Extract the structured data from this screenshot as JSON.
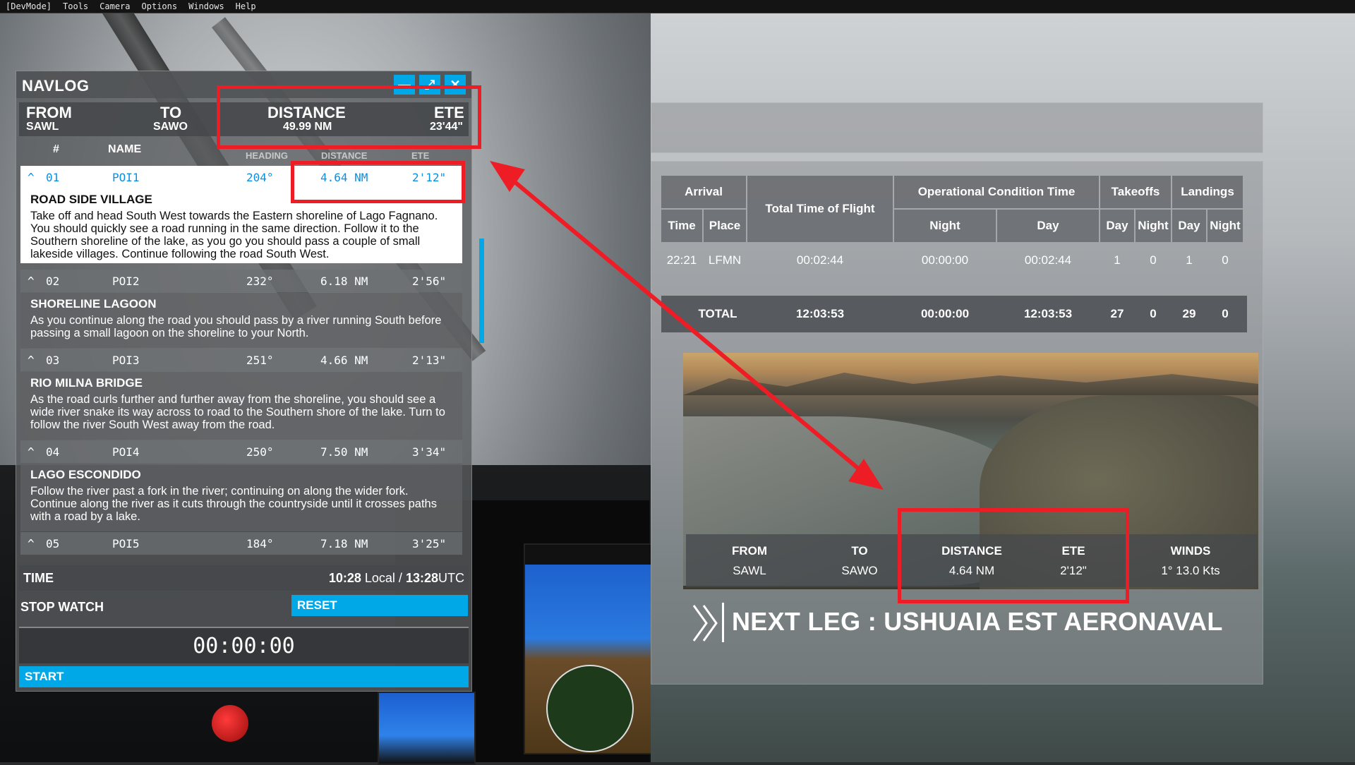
{
  "menu": [
    "[DevMode]",
    "Tools",
    "Camera",
    "Options",
    "Windows",
    "Help"
  ],
  "navlog": {
    "title": "NAVLOG",
    "window_buttons": {
      "minimize": "—",
      "maximize": "⤢",
      "close": "✕"
    },
    "summary": {
      "from_label": "FROM",
      "from_value": "SAWL",
      "to_label": "TO",
      "to_value": "SAWO",
      "distance_label": "DISTANCE",
      "distance_value": "49.99 NM",
      "ete_label": "ETE",
      "ete_value": "23'44\""
    },
    "columns": [
      "#",
      "NAME",
      "HEADING",
      "DISTANCE",
      "ETE"
    ],
    "legs": [
      {
        "num": "01",
        "name": "POI1",
        "heading": "204°",
        "distance": "4.64 NM",
        "ete": "2'12\"",
        "title": "ROAD SIDE VILLAGE",
        "text": "Take off and head South West towards the Eastern shoreline of Lago Fagnano. You should quickly see a road running in the same direction. Follow it to the Southern shoreline of the lake, as you go you should pass a couple of small lakeside villages. Continue following the road South West."
      },
      {
        "num": "02",
        "name": "POI2",
        "heading": "232°",
        "distance": "6.18 NM",
        "ete": "2'56\"",
        "title": "SHORELINE LAGOON",
        "text": "As you continue along the road you should pass by a river running South before passing a small lagoon on the shoreline to your North."
      },
      {
        "num": "03",
        "name": "POI3",
        "heading": "251°",
        "distance": "4.66 NM",
        "ete": "2'13\"",
        "title": "RIO MILNA BRIDGE",
        "text": "As the road curls further and further away from the shoreline, you should see a wide river snake its way across to road to the Southern shore of the lake. Turn to follow the river South West away from the road."
      },
      {
        "num": "04",
        "name": "POI4",
        "heading": "250°",
        "distance": "7.50 NM",
        "ete": "3'34\"",
        "title": "LAGO ESCONDIDO",
        "text": "Follow the river past a fork in the river; continuing on along the wider fork. Continue along the river as it cuts through the countryside until it crosses paths with a road by a lake."
      },
      {
        "num": "05",
        "name": "POI5",
        "heading": "184°",
        "distance": "7.18 NM",
        "ete": "3'25\""
      }
    ],
    "time_label": "TIME",
    "time_local": "10:28",
    "time_local_suffix": "Local /",
    "time_utc": "13:28",
    "time_utc_suffix": "UTC",
    "stopwatch_label": "STOP WATCH",
    "reset_label": "RESET",
    "stopwatch_value": "00:00:00",
    "start_label": "START"
  },
  "logbook": {
    "headers": {
      "arrival": "Arrival",
      "time": "Time",
      "place": "Place",
      "total_time": "Total Time of Flight",
      "op_cond": "Operational Condition Time",
      "night": "Night",
      "day": "Day",
      "takeoffs": "Takeoffs",
      "landings": "Landings"
    },
    "row": {
      "time": "22:21",
      "place": "LFMN",
      "total": "00:02:44",
      "night": "00:00:00",
      "day": "00:02:44",
      "to_day": "1",
      "to_night": "0",
      "ld_day": "1",
      "ld_night": "0"
    },
    "total_row": {
      "label": "TOTAL",
      "total": "12:03:53",
      "night": "00:00:00",
      "day": "12:03:53",
      "to_day": "27",
      "to_night": "0",
      "ld_day": "29",
      "ld_night": "0"
    }
  },
  "leg_info": {
    "from_label": "FROM",
    "from_value": "SAWL",
    "to_label": "TO",
    "to_value": "SAWO",
    "distance_label": "DISTANCE",
    "distance_value": "4.64 NM",
    "ete_label": "ETE",
    "ete_value": "2'12\"",
    "winds_label": "WINDS",
    "winds_value": "1° 13.0 Kts"
  },
  "next_leg": "NEXT LEG : USHUAIA EST AERONAVAL",
  "colors": {
    "accent": "#00a8e8",
    "annotation": "#ee1c25"
  }
}
